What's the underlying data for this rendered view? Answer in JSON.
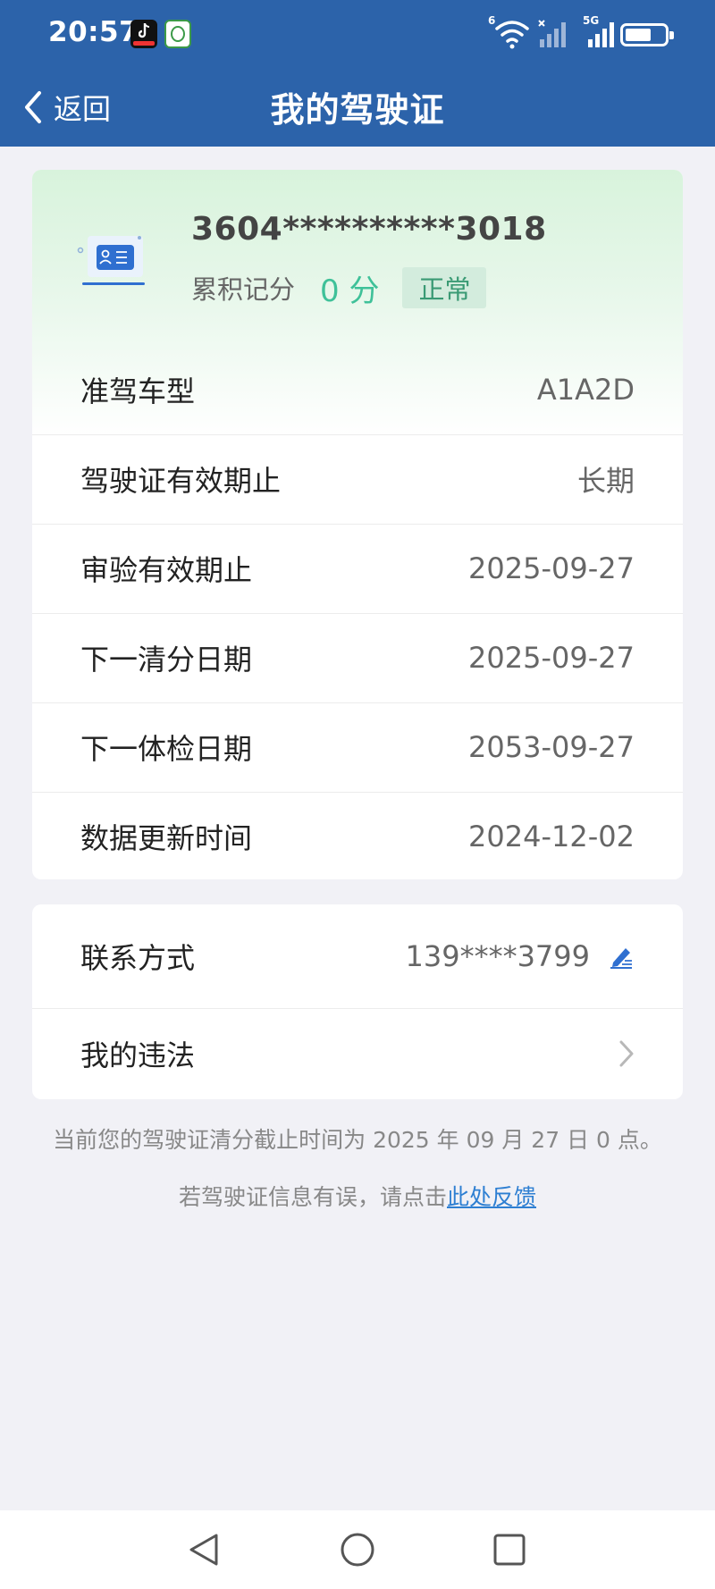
{
  "status_bar": {
    "time": "20:57",
    "wifi_badge": "6",
    "network": "5G",
    "icons": [
      "tiktok-app-icon",
      "green-app-icon",
      "wifi-icon",
      "signal-icon",
      "battery-icon"
    ]
  },
  "nav": {
    "back_label": "返回",
    "title": "我的驾驶证"
  },
  "license": {
    "number": "3604**********3018",
    "points_label": "累积记分",
    "points_value": "0 分",
    "status": "正常"
  },
  "info_rows": [
    {
      "label": "准驾车型",
      "value": "A1A2D"
    },
    {
      "label": "驾驶证有效期止",
      "value": "长期"
    },
    {
      "label": "审验有效期止",
      "value": "2025-09-27"
    },
    {
      "label": "下一清分日期",
      "value": "2025-09-27"
    },
    {
      "label": "下一体检日期",
      "value": "2053-09-27"
    },
    {
      "label": "数据更新时间",
      "value": "2024-12-02"
    }
  ],
  "contact": {
    "label": "联系方式",
    "value": "139****3799"
  },
  "violations": {
    "label": "我的违法"
  },
  "notice": "当前您的驾驶证清分截止时间为 2025 年 09 月 27 日 0 点。",
  "feedback": {
    "prefix": "若驾驶证信息有误，请点击",
    "link": "此处反馈"
  },
  "colors": {
    "header": "#2c63aa",
    "points_green": "#3fc199",
    "link_blue": "#2e7fd2",
    "background": "#f1f1f6"
  }
}
